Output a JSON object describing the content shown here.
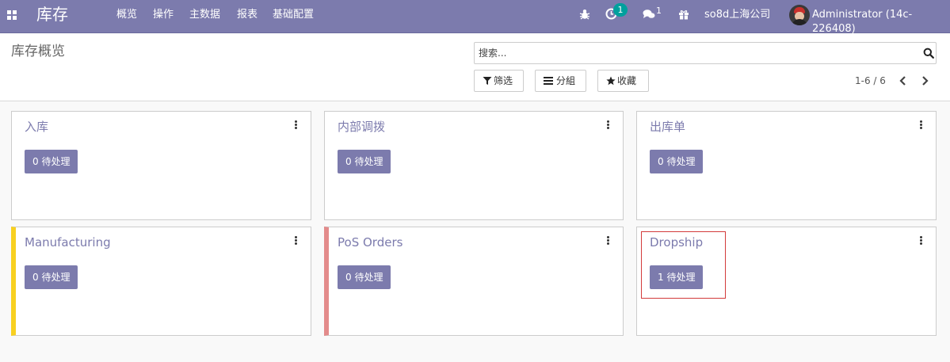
{
  "navbar": {
    "app_name": "库存",
    "menu": [
      "概览",
      "操作",
      "主数据",
      "报表",
      "基础配置"
    ],
    "activity_count": "1",
    "chat_count": "1",
    "company": "so8d上海公司",
    "user": "Administrator (14c-226408)",
    "bg_color": "#7c7bad",
    "badge_color": "#00a09d"
  },
  "control": {
    "title": "库存概览",
    "search_placeholder": "搜索...",
    "filter_label": "筛选",
    "group_label": "分組",
    "favorites_label": "收藏",
    "pager": "1-6 / 6"
  },
  "cards": [
    {
      "name": "入库",
      "pending": "0 待处理"
    },
    {
      "name": "内部调拨",
      "pending": "0 待处理"
    },
    {
      "name": "出库单",
      "pending": "0 待处理"
    },
    {
      "name": "Manufacturing",
      "pending": "0 待处理",
      "stripe_color": "#f8d020"
    },
    {
      "name": "PoS Orders",
      "pending": "0 待处理",
      "stripe_color": "#e38b8b"
    },
    {
      "name": "Dropship",
      "pending": "1 待处理"
    }
  ]
}
